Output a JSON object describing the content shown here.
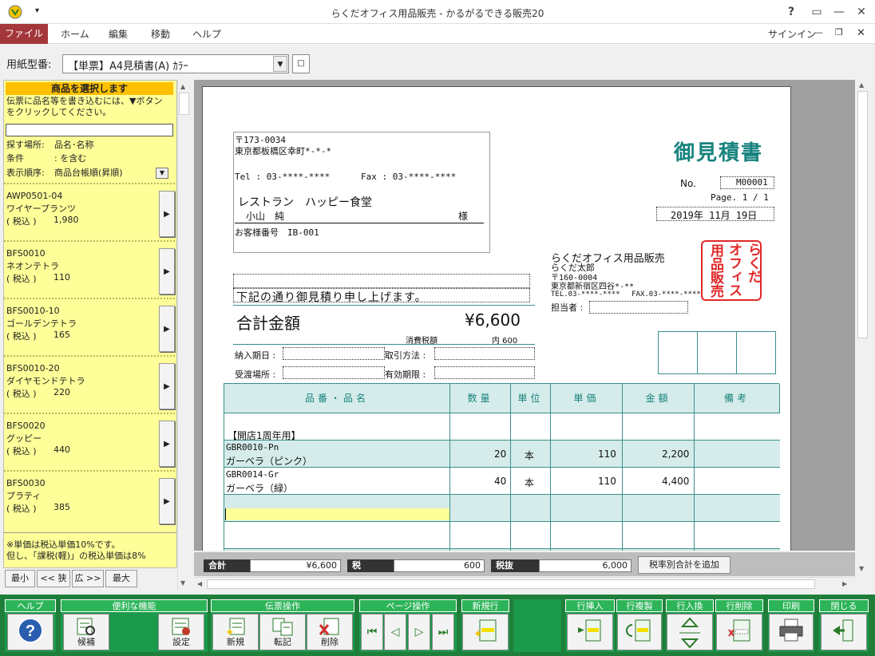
{
  "window": {
    "title": "らくだオフィス用品販売 - かるがるできる販売20",
    "help": "?",
    "signin": "サインイン"
  },
  "ribbon": {
    "file": "ファイル",
    "tabs": [
      "ホーム",
      "編集",
      "移動",
      "ヘルプ"
    ]
  },
  "paper": {
    "label": "用紙型番:",
    "value": "【単票】A4見積書(A) ｶﾗｰ"
  },
  "left_panel": {
    "header": "商品を選択します",
    "instruction1": "伝票に品名等を書き込むには、▼ボタン",
    "instruction2": "をクリックしてください。",
    "search_label": "探す場所:",
    "search_value": "品名･名称",
    "condition_label": "条件",
    "condition_value": ": を含む",
    "order_label": "表示順序:",
    "order_value": "商品台帳順(昇順)",
    "products": [
      {
        "code": "AWP0501-04",
        "name": "ワイヤープランツ",
        "tax": "( 税込 )",
        "price": "1,980"
      },
      {
        "code": "BFS0010",
        "name": "ネオンテトラ",
        "tax": "( 税込 )",
        "price": "110"
      },
      {
        "code": "BFS0010-10",
        "name": "ゴールデンテトラ",
        "tax": "( 税込 )",
        "price": "165"
      },
      {
        "code": "BFS0010-20",
        "name": "ダイヤモンドテトラ",
        "tax": "( 税込 )",
        "price": "220"
      },
      {
        "code": "BFS0020",
        "name": "グッピー",
        "tax": "( 税込 )",
        "price": "440"
      },
      {
        "code": "BFS0030",
        "name": "プラティ",
        "tax": "( 税込 )",
        "price": "385"
      }
    ],
    "note1": "※単価は税込単価10%です。",
    "note2": "但し、「課税(軽)」の税込単価は8%",
    "nav": [
      "最小",
      "<< 狭",
      "広 >>",
      "最大"
    ]
  },
  "doc": {
    "postal": "〒173-0034",
    "address": "東京都板橋区幸町*-*-*",
    "tel": "Tel : 03-****-****",
    "fax": "Fax : 03-****-****",
    "customer": "レストラン　ハッピー食堂",
    "contact": "小山　純",
    "honorific": "様",
    "cust_no": "お客様番号　IB-001",
    "title": "御見積書",
    "no_label": "No.",
    "no_value": "M00001",
    "page": "Page. 1 / 1",
    "date": "2019年 11月 19日",
    "message": "下記の通り御見積り申し上げます。",
    "total_label": "合計金額",
    "total_value": "¥6,600",
    "tax_label": "消費税額",
    "tax_value": "内 600",
    "delivery_date": "納入期日 :",
    "payment": "取引方法 :",
    "delivery_place": "受渡場所 :",
    "validity": "有効期限 :",
    "company": "らくだオフィス用品販売",
    "person": "らくだ太郎",
    "co_postal": "〒160-0004",
    "co_address": "東京都新宿区四谷*-**",
    "co_tel": "TEL.03-****-****　 FAX.03-****-****",
    "staff": "担当者 :",
    "stamp": [
      "らくだ",
      "オフィス",
      "用品販売"
    ]
  },
  "table": {
    "headers": [
      "品番・品名",
      "数量",
      "単位",
      "単価",
      "金額",
      "備考"
    ],
    "section": "【開店1周年用】",
    "rows": [
      {
        "code": "GBR0010-Pn",
        "name": "ガーベラ（ピンク）",
        "qty": "20",
        "unit": "本",
        "price": "110",
        "amount": "2,200"
      },
      {
        "code": "GBR0014-Gr",
        "name": "ガーベラ（緑）",
        "qty": "40",
        "unit": "本",
        "price": "110",
        "amount": "4,400"
      }
    ]
  },
  "totals": {
    "sum_label": "合計",
    "sum_value": "¥6,600",
    "tax_label": "税",
    "tax_value": "600",
    "net_label": "税抜",
    "net_value": "6,000",
    "add_button": "税率別合計を追加"
  },
  "toolbar": {
    "help": "ヘルプ",
    "convenient": "便利な機能",
    "candidate": "候補",
    "settings": "設定",
    "slip_ops": "伝票操作",
    "new": "新規",
    "transfer": "転記",
    "delete": "削除",
    "page_ops": "ページ操作",
    "new_row": "新規行",
    "row_insert": "行挿入",
    "row_copy": "行複製",
    "row_swap": "行入換",
    "row_delete": "行削除",
    "print": "印刷",
    "close": "閉じる"
  }
}
